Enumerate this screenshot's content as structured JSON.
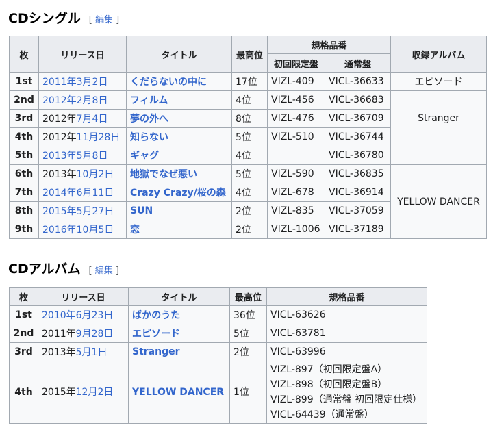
{
  "singles": {
    "heading": "CDシングル",
    "edit_label": "編集",
    "headers": {
      "num": "枚",
      "date": "リリース日",
      "title": "タイトル",
      "peak": "最高位",
      "catalog": "規格品番",
      "limited": "初回限定盤",
      "regular": "通常盤",
      "album": "収録アルバム"
    },
    "rows": [
      {
        "num": "1st",
        "date_link": "2011年3月2日",
        "date_pre": "",
        "date_mid": "",
        "date_post": "",
        "title": "くだらないの中に",
        "peak": "17位",
        "limited": "VIZL-409",
        "regular": "VICL-36633"
      },
      {
        "num": "2nd",
        "date_link": "2012年2月8日",
        "date_pre": "",
        "date_mid": "",
        "date_post": "",
        "title": "フィルム",
        "peak": "4位",
        "limited": "VIZL-456",
        "regular": "VICL-36683"
      },
      {
        "num": "3rd",
        "date_link": "",
        "date_pre": "2012年",
        "date_mid": "7月4日",
        "date_post": "",
        "title": "夢の外へ",
        "peak": "8位",
        "limited": "VIZL-476",
        "regular": "VICL-36709"
      },
      {
        "num": "4th",
        "date_link": "",
        "date_pre": "2012年",
        "date_mid": "11月28日",
        "date_post": "",
        "title": "知らない",
        "peak": "5位",
        "limited": "VIZL-510",
        "regular": "VICL-36744"
      },
      {
        "num": "5th",
        "date_link": "2013年5月8日",
        "date_pre": "",
        "date_mid": "",
        "date_post": "",
        "title": "ギャグ",
        "peak": "4位",
        "limited": "－",
        "regular": "VICL-36780"
      },
      {
        "num": "6th",
        "date_link": "",
        "date_pre": "2013年",
        "date_mid": "10月2日",
        "date_post": "",
        "title": "地獄でなぜ悪い",
        "peak": "5位",
        "limited": "VIZL-590",
        "regular": "VICL-36835"
      },
      {
        "num": "7th",
        "date_link": "2014年6月11日",
        "date_pre": "",
        "date_mid": "",
        "date_post": "",
        "title": "Crazy Crazy/桜の森",
        "peak": "4位",
        "limited": "VIZL-678",
        "regular": "VICL-36914"
      },
      {
        "num": "8th",
        "date_link": "2015年5月27日",
        "date_pre": "",
        "date_mid": "",
        "date_post": "",
        "title": "SUN",
        "peak": "2位",
        "limited": "VIZL-835",
        "regular": "VICL-37059"
      },
      {
        "num": "9th",
        "date_link": "2016年10月5日",
        "date_pre": "",
        "date_mid": "",
        "date_post": "",
        "title": "恋",
        "peak": "2位",
        "limited": "VIZL-1006",
        "regular": "VICL-37189"
      }
    ],
    "albums": [
      "エピソード",
      "Stranger",
      "－",
      "YELLOW DANCER"
    ]
  },
  "albums": {
    "heading": "CDアルバム",
    "edit_label": "編集",
    "headers": {
      "num": "枚",
      "date": "リリース日",
      "title": "タイトル",
      "peak": "最高位",
      "catalog": "規格品番"
    },
    "rows": [
      {
        "num": "1st",
        "date_link": "2010年6月23日",
        "date_pre": "",
        "date_mid": "",
        "date_post": "",
        "title": "ばかのうた",
        "peak": "36位",
        "catalog": [
          "VICL-63626"
        ]
      },
      {
        "num": "2nd",
        "date_link": "",
        "date_pre": "2011年",
        "date_mid": "9月28日",
        "date_post": "",
        "title": "エピソード",
        "peak": "5位",
        "catalog": [
          "VICL-63781"
        ]
      },
      {
        "num": "3rd",
        "date_link": "",
        "date_pre": "2013年",
        "date_mid": "5月1日",
        "date_post": "",
        "title": "Stranger",
        "peak": "2位",
        "catalog": [
          "VICL-63996"
        ]
      },
      {
        "num": "4th",
        "date_link": "",
        "date_pre": "2015年",
        "date_mid": "12月2日",
        "date_post": "",
        "title": "YELLOW DANCER",
        "peak": "1位",
        "catalog": [
          "VIZL-897（初回限定盤A）",
          "VIZL-898（初回限定盤B）",
          "VIZL-899（通常盤 初回限定仕様）",
          "VICL-64439（通常盤）"
        ]
      }
    ]
  }
}
